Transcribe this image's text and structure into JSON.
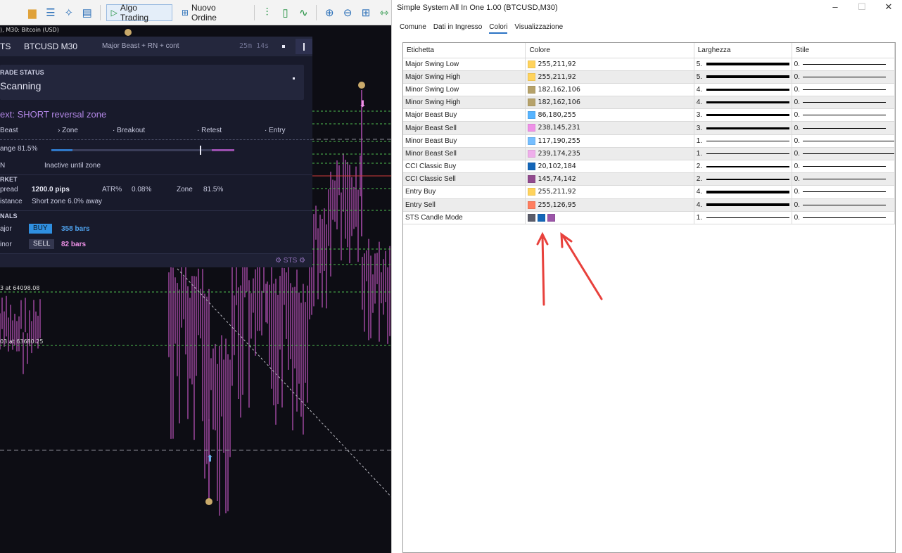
{
  "toolbar": {
    "algo_trading": "Algo Trading",
    "new_order": "Nuovo Ordine"
  },
  "chart": {
    "header": "), M30: Bitcoin (USD)",
    "level_label_1": "3 at 64098.08",
    "level_label_2": "03 at 63680.25"
  },
  "dashboard": {
    "tag": "TS",
    "symbol": "BTCUSD M30",
    "mode": "Major Beast + RN + cont",
    "timer": "25m 14s",
    "status_caption": "RADE STATUS",
    "status_value": "Scanning",
    "next": "ext: SHORT reversal zone",
    "steps": [
      "Beast",
      "› Zone",
      "· Breakout",
      "· Retest",
      "· Entry"
    ],
    "range_label": "ange 81.5%",
    "range_value": 0.815,
    "rn_label": "N",
    "rn_value": "Inactive until zone",
    "market_caption": "RKET",
    "spread_label": "pread",
    "spread_value": "1200.0 pips",
    "atr_label": "ATR%",
    "atr_value": "0.08%",
    "zone_label": "Zone",
    "zone_value": "81.5%",
    "distance_label": "istance",
    "distance_value": "Short zone 6.0% away",
    "signals_caption": "NALS",
    "major_label": "ajor",
    "major_badge": "BUY",
    "major_bars": "358 bars",
    "minor_label": "inor",
    "minor_badge": "SELL",
    "minor_bars": "82 bars",
    "footer": "⚙ STS ⚙"
  },
  "dialog": {
    "title": "Simple System All In One 1.00 (BTCUSD,M30)",
    "tabs": [
      "Comune",
      "Dati in Ingresso",
      "Colori",
      "Visualizzazione"
    ],
    "columns": [
      "Etichetta",
      "Colore",
      "Larghezza",
      "Stile"
    ],
    "rows": [
      {
        "label": "Major Swing Low",
        "color": "#FFD35C",
        "value": "255,211,92",
        "width": "5.",
        "style": "0."
      },
      {
        "label": "Major Swing High",
        "color": "#FFD35C",
        "value": "255,211,92",
        "width": "5.",
        "style": "0."
      },
      {
        "label": "Minor Swing Low",
        "color": "#B6A26A",
        "value": "182,162,106",
        "width": "4.",
        "style": "0."
      },
      {
        "label": "Minor Swing High",
        "color": "#B6A26A",
        "value": "182,162,106",
        "width": "4.",
        "style": "0."
      },
      {
        "label": "Major Beast Buy",
        "color": "#56B4FF",
        "value": "86,180,255",
        "width": "3.",
        "style": "0."
      },
      {
        "label": "Major Beast Sell",
        "color": "#EE91E7",
        "value": "238,145,231",
        "width": "3.",
        "style": "0."
      },
      {
        "label": "Minor Beast Buy",
        "color": "#75BEFF",
        "value": "117,190,255",
        "width": "1.",
        "style": "0."
      },
      {
        "label": "Minor Beast Sell",
        "color": "#EFAEEB",
        "value": "239,174,235",
        "width": "1.",
        "style": "0."
      },
      {
        "label": "CCI Classic Buy",
        "color": "#1466B8",
        "value": "20,102,184",
        "width": "2.",
        "style": "0."
      },
      {
        "label": "CCI Classic Sell",
        "color": "#914A8E",
        "value": "145,74,142",
        "width": "2.",
        "style": "0."
      },
      {
        "label": "Entry Buy",
        "color": "#FFD35C",
        "value": "255,211,92",
        "width": "4.",
        "style": "0."
      },
      {
        "label": "Entry Sell",
        "color": "#FF7E5F",
        "value": "255,126,95",
        "width": "4.",
        "style": "0."
      },
      {
        "label": "STS Candle Mode",
        "swatches": [
          "#5A5C6A",
          "#1466B8",
          "#9B55A8"
        ],
        "width": "1.",
        "style": "0."
      }
    ]
  },
  "colors": {
    "arrow": "#E8413C",
    "candle": "#B14FB3",
    "chart_bg": "#0D0D14"
  }
}
